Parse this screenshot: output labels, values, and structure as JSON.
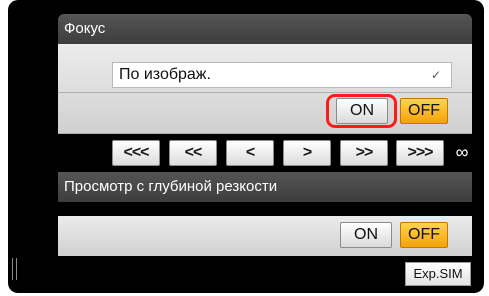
{
  "focus": {
    "header": "Фокус",
    "mode_select_value": "По изображ.",
    "on_label": "ON",
    "off_label": "OFF",
    "nav_buttons": [
      "<<<",
      "<<",
      "<",
      ">",
      ">>",
      ">>>"
    ],
    "infinity_symbol": "∞"
  },
  "dof_preview": {
    "header": "Просмотр с глубиной резкости",
    "on_label": "ON",
    "off_label": "OFF"
  },
  "exp_sim_label": "Exp.SIM",
  "colors": {
    "panel_bg": "#000000",
    "off_active": "#f3a20b",
    "highlight": "#ff1a1a"
  }
}
